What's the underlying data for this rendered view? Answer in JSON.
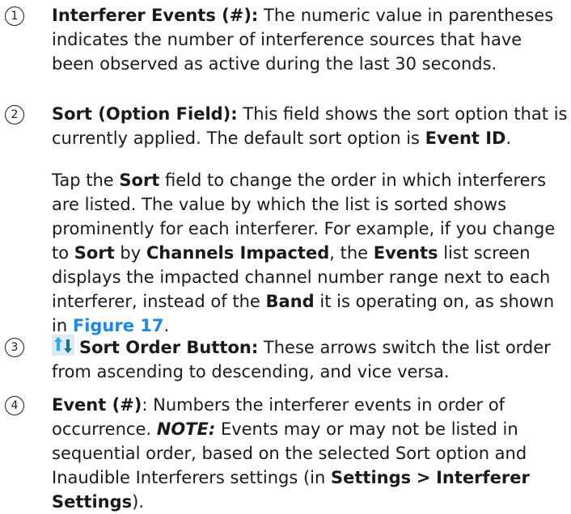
{
  "items": [
    {
      "number": "1",
      "title": "Interferer Events (#):",
      "text": "The numeric value in parentheses indicates the number of interference sources that have been observed as active during the last 30 seconds."
    },
    {
      "number": "2",
      "title": "Sort (Option Field):",
      "text": "This field shows the sort option that is currently applied. The default sort option is",
      "default_value": "Event ID",
      "period": ".",
      "para2": {
        "t1": "Tap the",
        "b1": "Sort",
        "t2": "field to change the order in which interferers are listed. The value by which the list is sorted shows prominently for each interferer. For example, if you change to",
        "b2": "Sort",
        "t3": "by",
        "b3": "Channels Impacted",
        "t4": ", the",
        "b4": "Events",
        "t5": "list screen displays the impacted channel number range next to each interferer, instead of the",
        "b5": "Band",
        "t6": "it is operating on, as shown in",
        "link": "Figure 17",
        "t7": "."
      }
    },
    {
      "number": "3",
      "icon": "sort-order-arrows-icon",
      "title": "Sort Order Button:",
      "text": "These arrows switch the list order from ascending to descending, and vice versa."
    },
    {
      "number": "4",
      "title": "Event (#)",
      "colon": ":",
      "text1": "Numbers the interferer events in order of occurrence.",
      "note": "NOTE:",
      "text2": "Events may or may not be listed in sequential order, based on the selected Sort option and Inaudible Interferers settings (in",
      "settings": "Settings",
      "sep": ">",
      "interferer_settings": "Interferer Settings",
      "text3": ")."
    }
  ],
  "colors": {
    "link": "#1e88e5",
    "icon_up": "#2eaadc",
    "icon_down": "#1f6f8b"
  }
}
